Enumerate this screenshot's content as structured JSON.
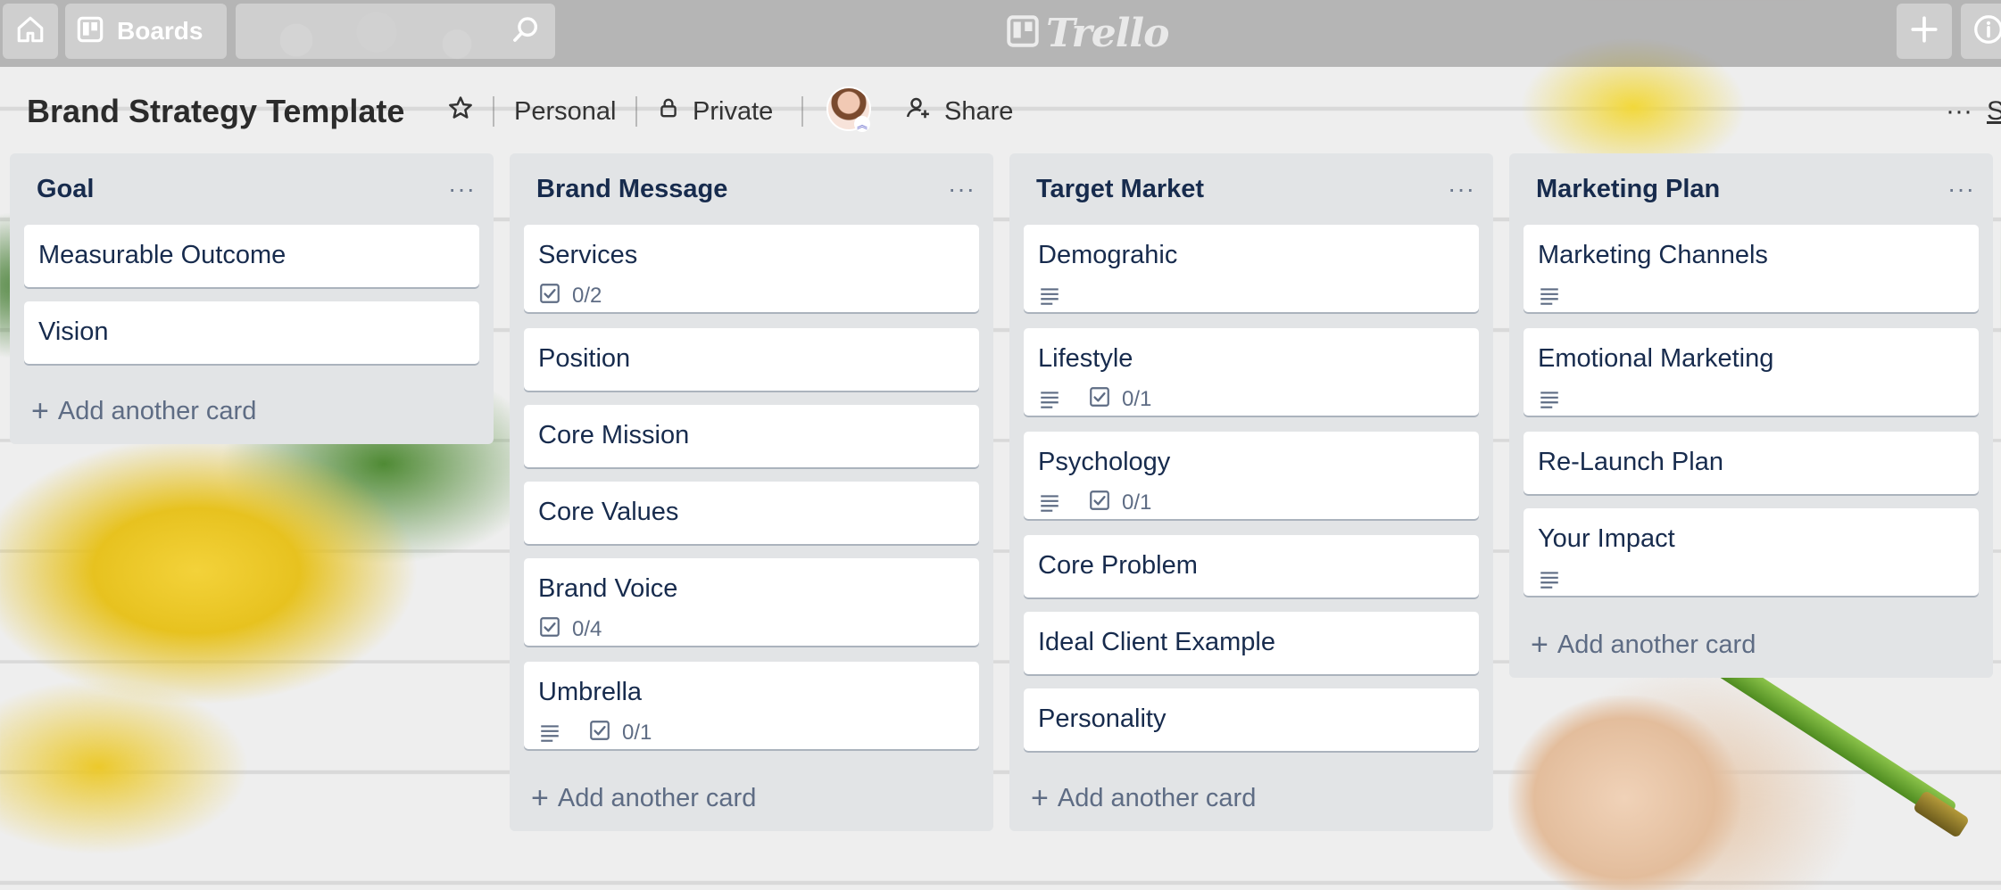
{
  "topbar": {
    "home_icon": "home-icon",
    "boards_label": "Boards",
    "search_icon": "search-icon",
    "logo_text": "Trello",
    "plus_icon": "plus-icon",
    "info_icon": "info-icon"
  },
  "board": {
    "title": "Brand Strategy Template",
    "team": "Personal",
    "privacy": "Private",
    "share": "Share",
    "menu_label": "S"
  },
  "lists": [
    {
      "title": "Goal",
      "cards": [
        {
          "title": "Measurable Outcome"
        },
        {
          "title": "Vision"
        }
      ],
      "add_label": "Add another card"
    },
    {
      "title": "Brand Message",
      "cards": [
        {
          "title": "Services",
          "checklist": "0/2"
        },
        {
          "title": "Position"
        },
        {
          "title": "Core Mission"
        },
        {
          "title": "Core Values"
        },
        {
          "title": "Brand Voice",
          "checklist": "0/4"
        },
        {
          "title": "Umbrella",
          "description": true,
          "checklist": "0/1"
        }
      ],
      "add_label": "Add another card"
    },
    {
      "title": "Target Market",
      "cards": [
        {
          "title": "Demograhic",
          "description": true
        },
        {
          "title": "Lifestyle",
          "description": true,
          "checklist": "0/1"
        },
        {
          "title": "Psychology",
          "description": true,
          "checklist": "0/1"
        },
        {
          "title": "Core Problem"
        },
        {
          "title": "Ideal Client Example"
        },
        {
          "title": "Personality"
        }
      ],
      "add_label": "Add another card"
    },
    {
      "title": "Marketing Plan",
      "cards": [
        {
          "title": "Marketing Channels",
          "description": true
        },
        {
          "title": "Emotional Marketing",
          "description": true
        },
        {
          "title": "Re-Launch Plan"
        },
        {
          "title": "Your Impact",
          "description": true
        }
      ],
      "add_label": "Add another card"
    }
  ]
}
